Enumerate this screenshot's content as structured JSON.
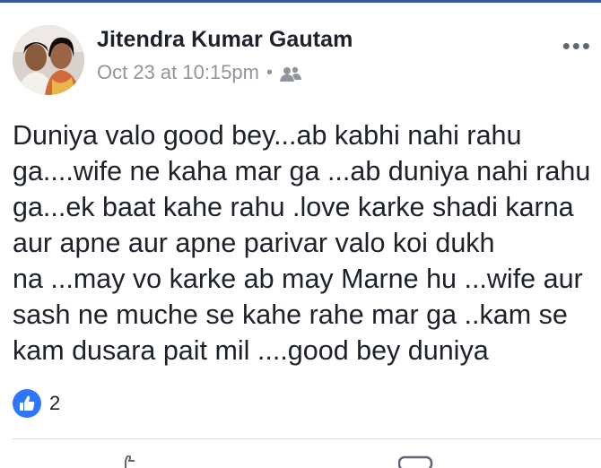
{
  "post": {
    "author": "Jitendra Kumar Gautam",
    "timestamp": "Oct 23 at 10:15pm",
    "separator": "•",
    "audience_icon": "friends-icon",
    "more_label": "•••",
    "text_lines": [
      "Duniya valo good bey...ab kabhi nahi rahu",
      "ga....wife ne kaha mar ga ...ab duniya nahi rahu",
      "ga...ek baat kahe rahu .love karke shadi karna",
      "aur apne  aur apne parivar valo koi dukh",
      "na ...may vo karke ab may Marne hu ...wife aur",
      "sash ne muche se kahe rahe mar ga ..kam se",
      "kam dusara pait mil ....good bey duniya"
    ],
    "reactions": {
      "icon": "like-icon",
      "count": "2"
    }
  },
  "colors": {
    "brand": "#3b5998",
    "like_blue": "#2f76ff",
    "meta_gray": "#90949c",
    "text": "#1d2129"
  }
}
